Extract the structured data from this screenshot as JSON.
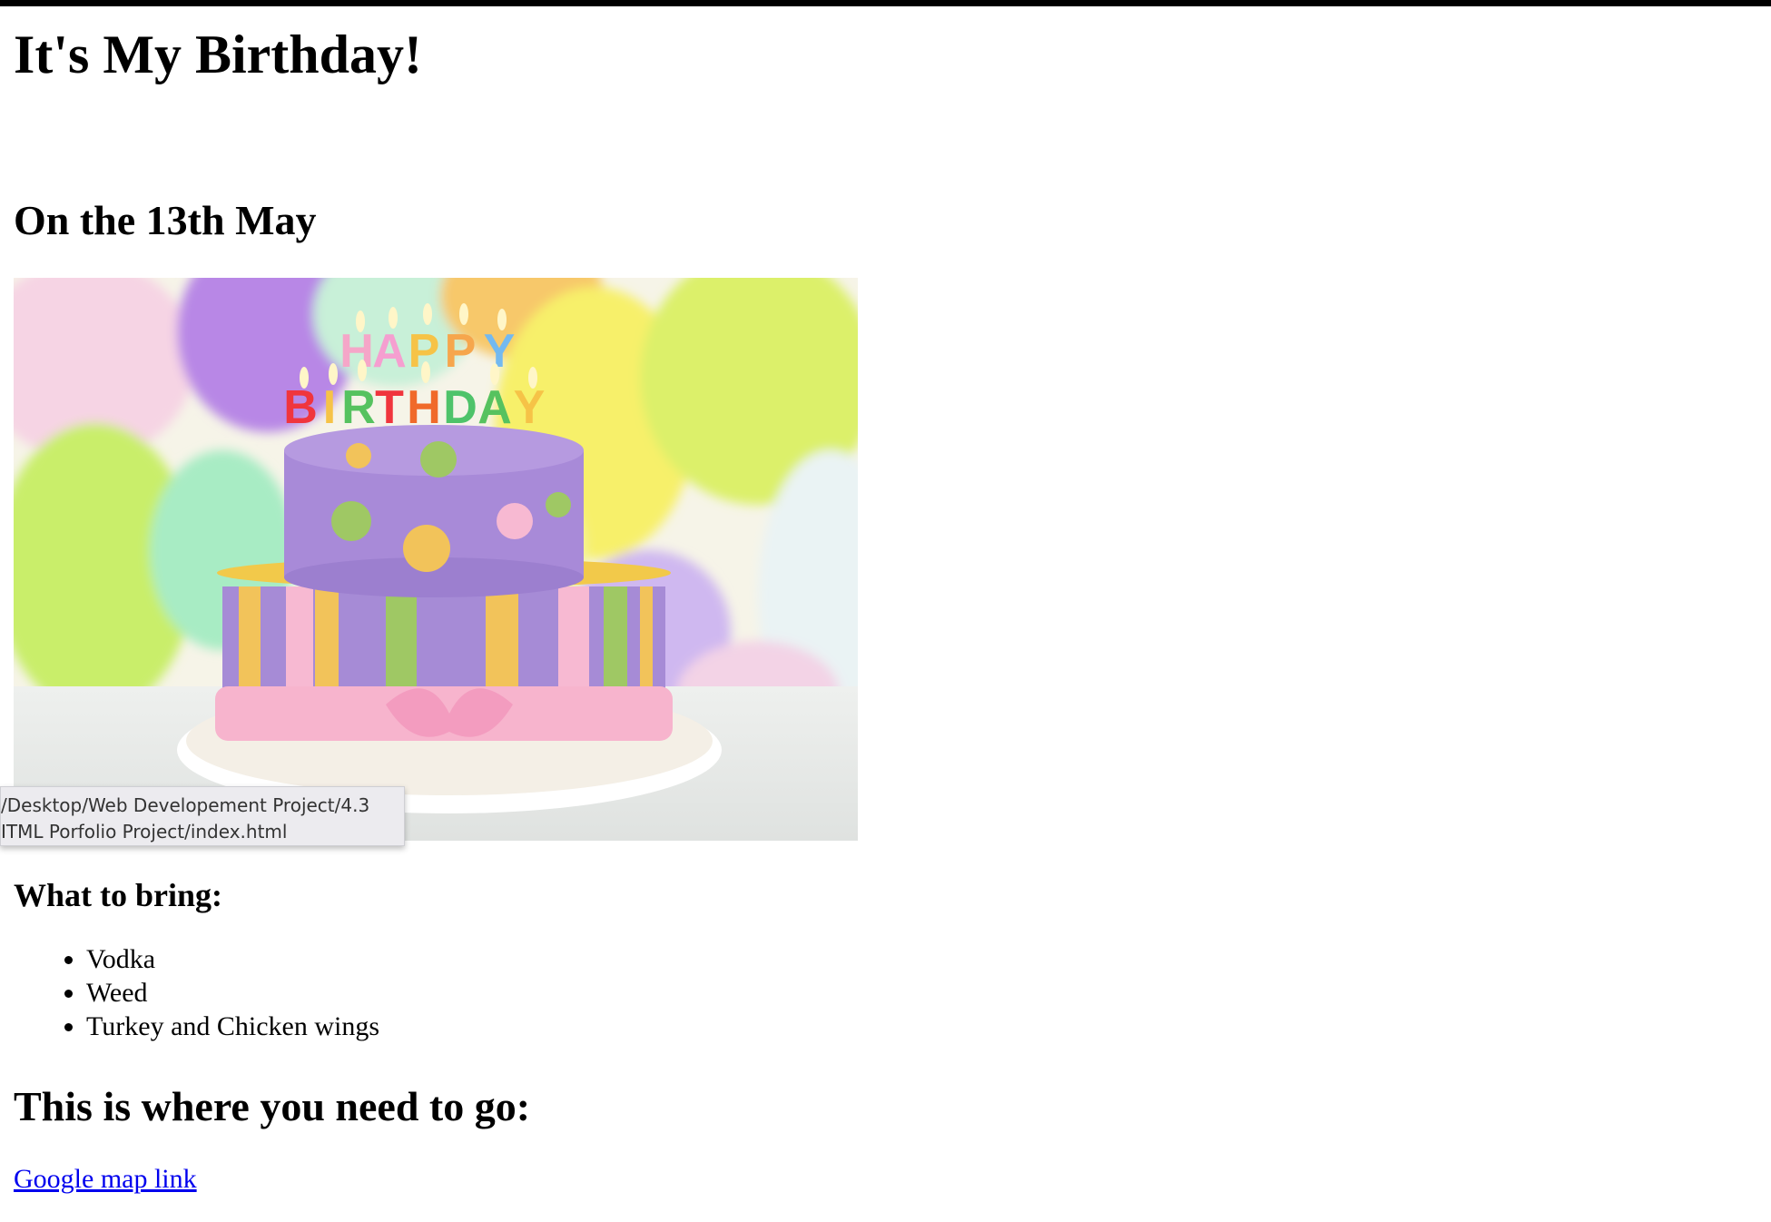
{
  "page": {
    "title": "It's My Birthday!",
    "date_heading": "On the 13th May",
    "image_alt": "birthday cake",
    "cake_letters": [
      "H",
      "A",
      "P",
      "P",
      "Y",
      "B",
      "I",
      "R",
      "T",
      "H",
      "D",
      "A",
      "Y"
    ],
    "bring_heading": "What to bring:",
    "bring_items": [
      "Vodka",
      "Weed",
      "Turkey and Chicken wings"
    ],
    "go_heading": "This is where you need to go:",
    "map_link": "Google map link"
  },
  "tooltip": {
    "line1": "/Desktop/Web Developement Project/4.3",
    "line2": "ITML Porfolio Project/index.html"
  }
}
